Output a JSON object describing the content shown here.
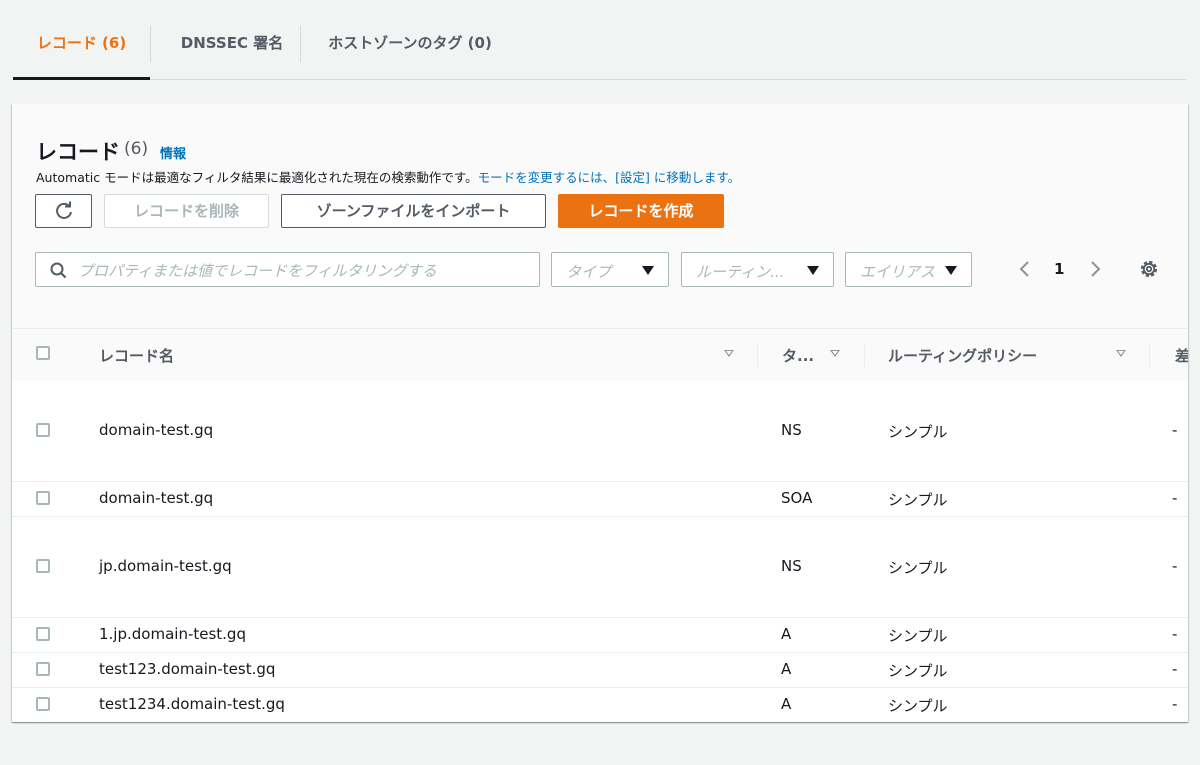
{
  "tabs": [
    {
      "label": "レコード (6)",
      "active": true
    },
    {
      "label": "DNSSEC 署名",
      "active": false
    },
    {
      "label": "ホストゾーンのタグ (0)",
      "active": false
    }
  ],
  "panel": {
    "title": "レコード",
    "count": "(6)",
    "info_link": "情報",
    "description_text": "Automatic モードは最適なフィルタ結果に最適化された現在の検索動作です。",
    "description_link": "モードを変更するには、[設定] に移動します。"
  },
  "toolbar": {
    "refresh_icon": "refresh-icon",
    "delete_label": "レコードを削除",
    "import_label": "ゾーンファイルをインポート",
    "create_label": "レコードを作成"
  },
  "filters": {
    "search_placeholder": "プロパティまたは値でレコードをフィルタリングする",
    "type_select": "タイプ",
    "routing_select": "ルーティン...",
    "alias_select": "エイリアス"
  },
  "pagination": {
    "current_page": "1"
  },
  "table": {
    "headers": {
      "name": "レコード名",
      "type": "タ...",
      "policy": "ルーティングポリシー",
      "alias_partial": "差"
    },
    "rows": [
      {
        "name": "domain-test.gq",
        "type": "NS",
        "policy": "シンプル",
        "alias": "-"
      },
      {
        "name": "domain-test.gq",
        "type": "SOA",
        "policy": "シンプル",
        "alias": "-"
      },
      {
        "name": "jp.domain-test.gq",
        "type": "NS",
        "policy": "シンプル",
        "alias": "-"
      },
      {
        "name": "1.jp.domain-test.gq",
        "type": "A",
        "policy": "シンプル",
        "alias": "-"
      },
      {
        "name": "test123.domain-test.gq",
        "type": "A",
        "policy": "シンプル",
        "alias": "-"
      },
      {
        "name": "test1234.domain-test.gq",
        "type": "A",
        "policy": "シンプル",
        "alias": "-"
      }
    ]
  },
  "colors": {
    "accent": "#ec7211",
    "link": "#0073bb",
    "text": "#16191f",
    "muted": "#545b64",
    "background": "#f2f3f3"
  }
}
